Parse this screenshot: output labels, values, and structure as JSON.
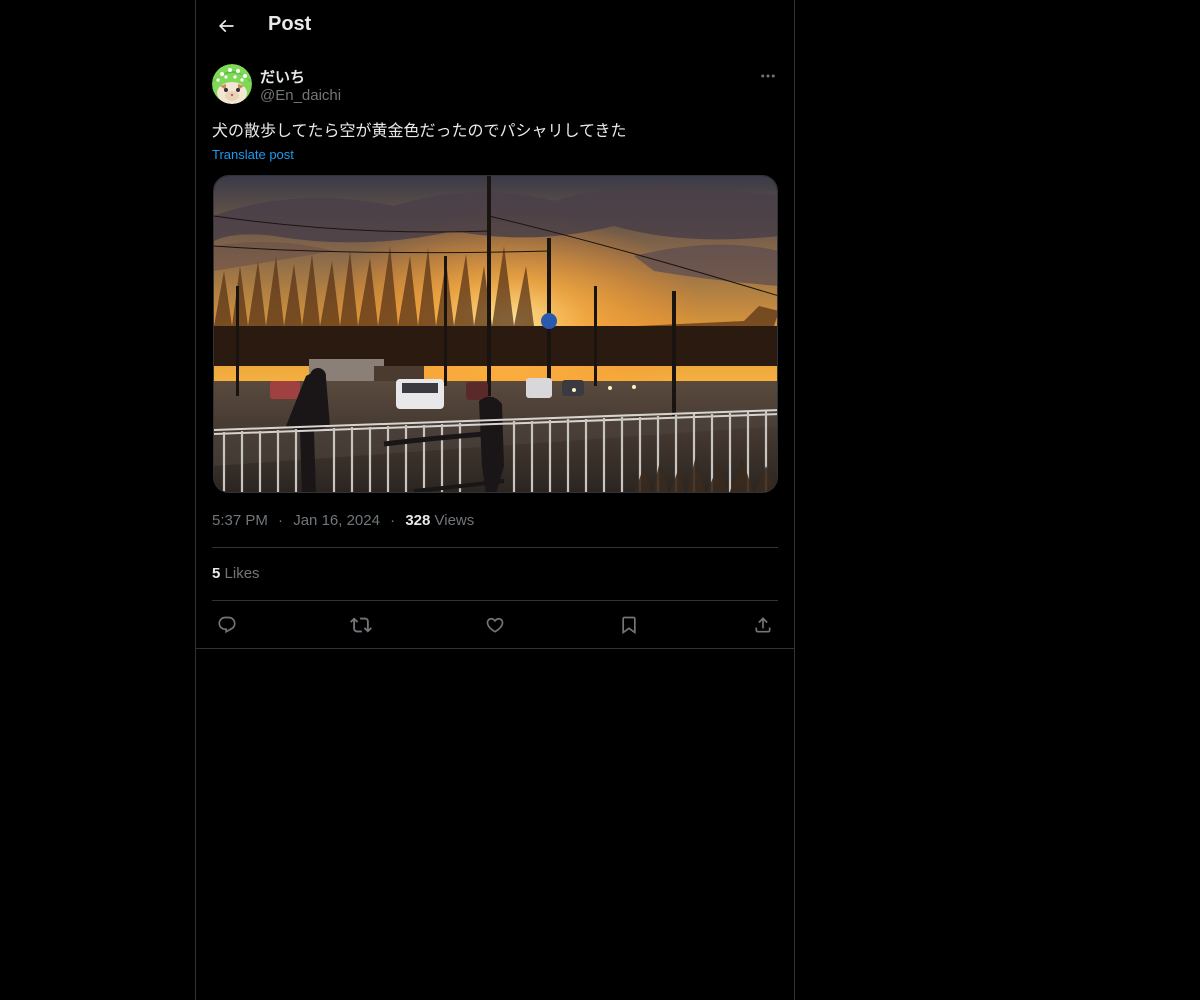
{
  "header": {
    "title": "Post"
  },
  "author": {
    "name": "だいち",
    "handle": "@En_daichi"
  },
  "tweet": {
    "text": "犬の散歩してたら空が黄金色だったのでパシャリしてきた",
    "translate_label": "Translate post"
  },
  "meta": {
    "time": "5:37 PM",
    "separator": "·",
    "date": "Jan 16, 2024",
    "views_count": "328",
    "views_label": "Views"
  },
  "engagement": {
    "likes_count": "5",
    "likes_label": "Likes"
  },
  "icons": {
    "back": "arrow-left-icon",
    "more": "more-horizontal-icon",
    "reply": "reply-icon",
    "repost": "repost-icon",
    "like": "heart-icon",
    "bookmark": "bookmark-icon",
    "share": "share-icon"
  },
  "colors": {
    "background": "#000000",
    "text_primary": "#e7e9ea",
    "text_secondary": "#71767b",
    "accent": "#1d9bf0",
    "border": "#2f3336"
  }
}
